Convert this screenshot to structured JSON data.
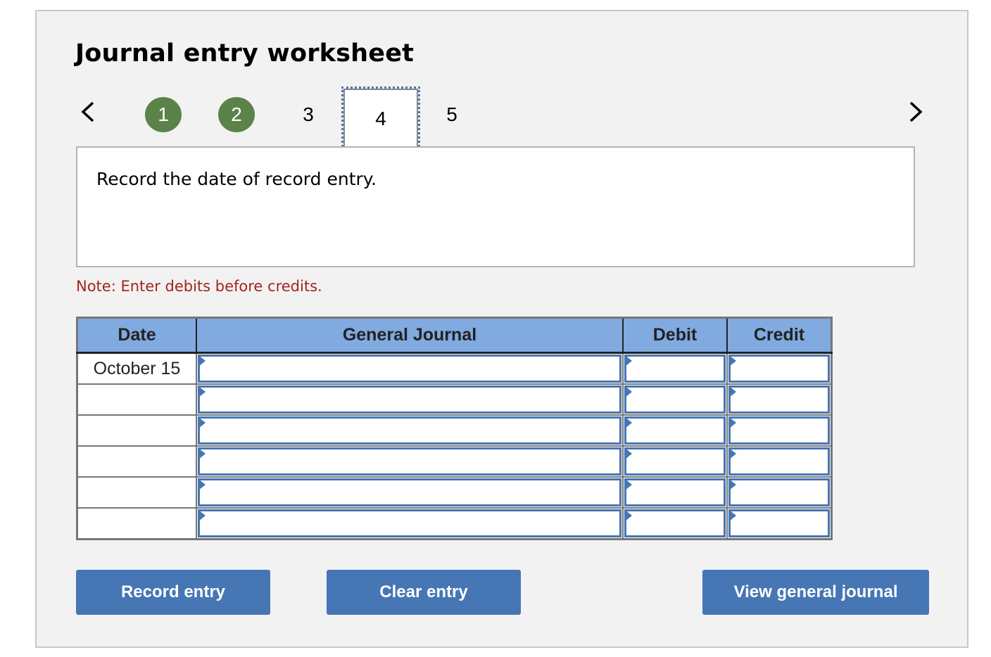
{
  "title": "Journal entry worksheet",
  "navigation": {
    "prev_icon": "chevron-left-icon",
    "next_icon": "chevron-right-icon",
    "steps": [
      {
        "label": "1",
        "state": "completed"
      },
      {
        "label": "2",
        "state": "completed"
      },
      {
        "label": "3",
        "state": "pending"
      },
      {
        "label": "4",
        "state": "current"
      },
      {
        "label": "5",
        "state": "pending"
      }
    ]
  },
  "prompt": "Record the date of record entry.",
  "note": "Note: Enter debits before credits.",
  "table": {
    "headers": [
      "Date",
      "General Journal",
      "Debit",
      "Credit"
    ],
    "rows": [
      {
        "date": "October 15",
        "account": "",
        "debit": "",
        "credit": ""
      },
      {
        "date": "",
        "account": "",
        "debit": "",
        "credit": ""
      },
      {
        "date": "",
        "account": "",
        "debit": "",
        "credit": ""
      },
      {
        "date": "",
        "account": "",
        "debit": "",
        "credit": ""
      },
      {
        "date": "",
        "account": "",
        "debit": "",
        "credit": ""
      },
      {
        "date": "",
        "account": "",
        "debit": "",
        "credit": ""
      }
    ]
  },
  "buttons": {
    "record": "Record entry",
    "clear": "Clear entry",
    "view": "View general journal"
  },
  "colors": {
    "completed_step": "#5a8249",
    "accent_blue": "#4676b4",
    "header_blue": "#80aae0",
    "note_red": "#a5231f"
  }
}
